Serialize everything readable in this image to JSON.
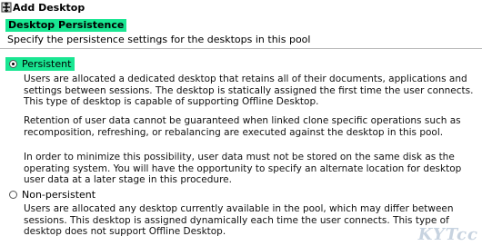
{
  "window": {
    "title": "Add Desktop",
    "icon": "wizard-app-icon"
  },
  "header": {
    "title": "Desktop Persistence",
    "subtitle": "Specify the persistence settings for the desktops in this pool",
    "highlight_color": "#19e692"
  },
  "options": [
    {
      "label": "Persistent",
      "selected": true,
      "paragraphs": [
        "Users are allocated a dedicated desktop that retains all of their documents, applications and settings between sessions. The desktop is statically assigned the first time the user connects. This type of desktop is capable of supporting Offline Desktop.",
        "Retention of user data cannot be guaranteed when linked clone specific operations such as recomposition, refreshing, or rebalancing are executed against the desktop in this pool.",
        "In order to minimize this possibility, user data must not be stored on the same disk as the operating system. You will have the opportunity to specify an alternate location for desktop user data at a later stage in this procedure."
      ]
    },
    {
      "label": "Non-persistent",
      "selected": false,
      "paragraphs": [
        "Users are allocated any desktop currently available in the pool, which may differ between sessions. This desktop is assigned dynamically each time the user connects. This type of desktop does not support Offline Desktop."
      ]
    }
  ],
  "watermark": {
    "text": "KYTcc"
  }
}
